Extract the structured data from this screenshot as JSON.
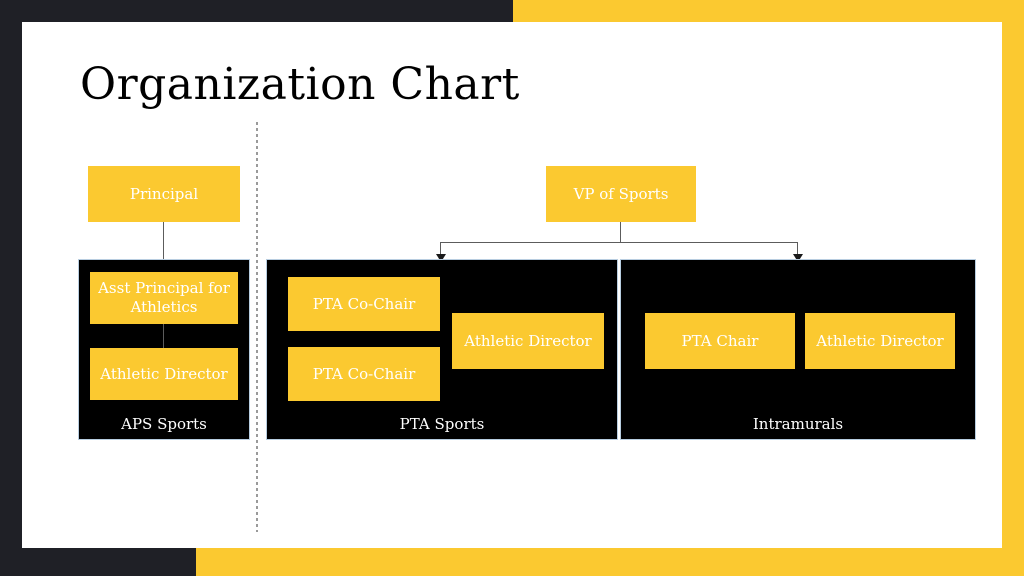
{
  "slide": {
    "title": "Organization Chart",
    "background_color": "#ffffff",
    "accent_color": "#fbc930",
    "dark_color": "#1f2026",
    "panel_color": "#000000",
    "node_text_color": "#ffffff"
  },
  "nodes": {
    "principal": "Principal",
    "vp_of_sports": "VP of Sports",
    "asst_principal": "Asst Principal for Athletics",
    "aps_athletic_director": "Athletic Director",
    "pta_co_chair_1": "PTA Co-Chair",
    "pta_co_chair_2": "PTA Co-Chair",
    "pta_athletic_director": "Athletic Director",
    "pta_chair": "PTA Chair",
    "intramurals_athletic_director": "Athletic Director"
  },
  "groups": {
    "aps_label": "APS Sports",
    "pta_label": "PTA Sports",
    "intramurals_label": "Intramurals"
  }
}
